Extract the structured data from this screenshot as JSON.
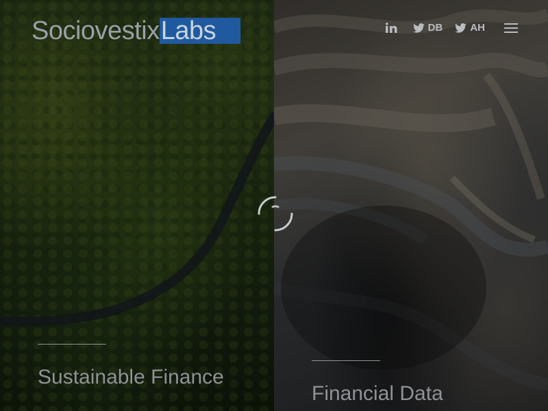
{
  "brand": {
    "name_part1": "Sociovestix",
    "name_part2": "Labs",
    "accent_color": "#1f5aa0"
  },
  "nav": {
    "linkedin": {
      "icon": "linkedin-icon",
      "label": ""
    },
    "twitter_db": {
      "icon": "twitter-icon",
      "label": "DB"
    },
    "twitter_ah": {
      "icon": "twitter-icon",
      "label": "AH"
    },
    "menu": {
      "icon": "hamburger-menu-icon"
    }
  },
  "panels": {
    "left": {
      "title": "Sustainable Finance"
    },
    "right": {
      "title": "Financial Data"
    }
  },
  "loader": {
    "icon": "loading-spinner-icon"
  }
}
